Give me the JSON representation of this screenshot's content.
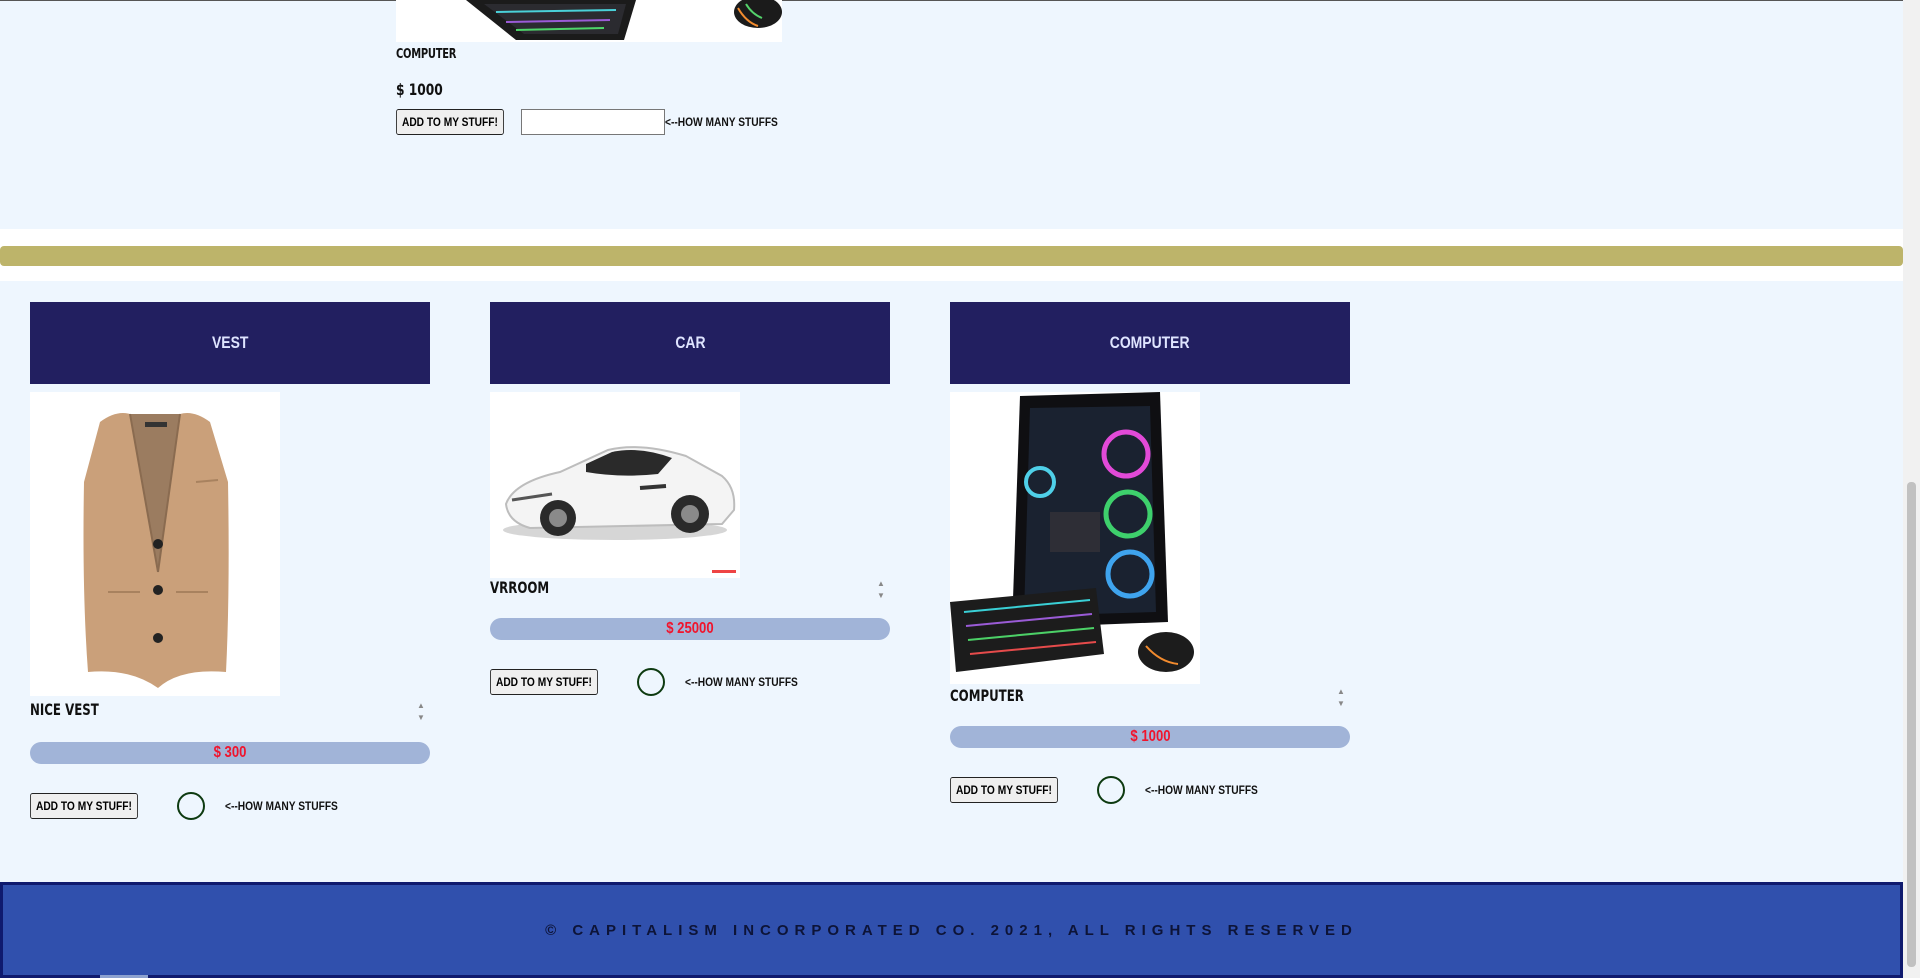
{
  "top_product": {
    "name": "COMPUTER",
    "price": "$ 1000",
    "add_button": "ADD TO MY STUFF!",
    "hint": "<--HOW MANY STUFFS"
  },
  "products": [
    {
      "title": "VEST",
      "image": "vest-image",
      "name": "NICE VEST",
      "price": "$ 300",
      "add_button": "ADD TO MY STUFF!",
      "hint": "<--HOW MANY STUFFS"
    },
    {
      "title": "CAR",
      "image": "car-image",
      "name": "VRROOM",
      "price": "$ 25000",
      "add_button": "ADD TO MY STUFF!",
      "hint": "<--HOW MANY STUFFS"
    },
    {
      "title": "COMPUTER",
      "image": "computer-image",
      "name": "COMPUTER",
      "price": "$ 1000",
      "add_button": "ADD TO MY STUFF!",
      "hint": "<--HOW MANY STUFFS"
    }
  ],
  "footer": {
    "text": "© CAPITALISM INCORPORATED CO. 2021, ALL RIGHTS RESERVED"
  },
  "colors": {
    "page_bg": "#eef6fe",
    "card_header": "#221f60",
    "price_bar": "#a1b4d8",
    "price_text": "#f0142c",
    "divider_gold": "#bdb46a",
    "footer_bg": "#3050ad"
  }
}
